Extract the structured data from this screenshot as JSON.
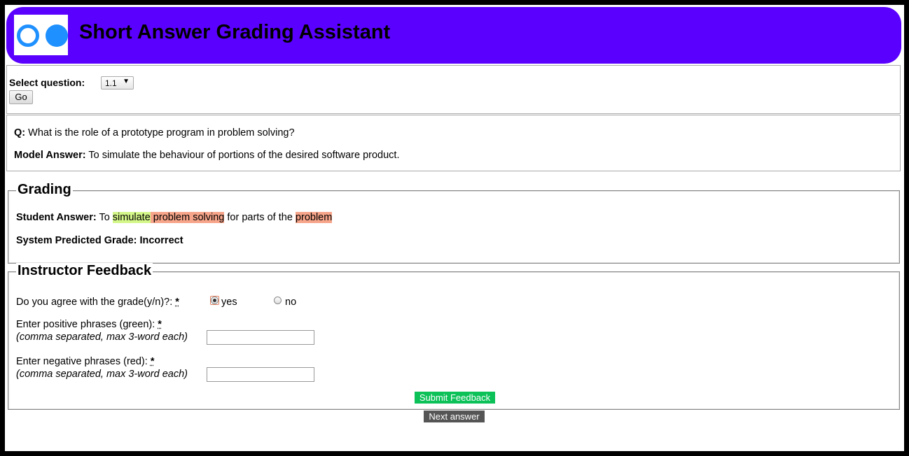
{
  "header": {
    "title": "Short Answer Grading Assistant"
  },
  "question_select": {
    "label": "Select question:",
    "selected": "1.1",
    "go_label": "Go"
  },
  "question": {
    "q_label": "Q:",
    "q_text": " What is the role of a prototype program in problem solving?",
    "model_label": "Model Answer:",
    "model_text": " To simulate the behaviour of portions of the desired software product."
  },
  "grading": {
    "legend": "Grading",
    "student_label": "Student Answer:",
    "answer_parts": [
      {
        "text": " To ",
        "highlight": "none"
      },
      {
        "text": "simulate",
        "highlight": "green"
      },
      {
        "text": " problem solving",
        "highlight": "red"
      },
      {
        "text": " for parts of the ",
        "highlight": "none"
      },
      {
        "text": "problem",
        "highlight": "red"
      }
    ],
    "predicted": "System Predicted Grade: Incorrect"
  },
  "feedback": {
    "legend": "Instructor Feedback",
    "agree_label": "Do you agree with the grade(y/n)?: ",
    "required_mark": "*",
    "yes_label": "yes",
    "no_label": "no",
    "selected": "yes",
    "positive_label": "Enter positive phrases (green): ",
    "negative_label": "Enter negative phrases (red): ",
    "hint": "(comma separated, max 3-word each)",
    "positive_value": "",
    "negative_value": "",
    "submit_label": "Submit Feedback",
    "next_label": "Next answer"
  },
  "colors": {
    "header_bg": "#5a00ff",
    "logo_blue": "#1e90ff",
    "highlight_green": "#d4f78a",
    "highlight_red": "#f7a58a",
    "submit_bg": "#0bc158",
    "next_bg": "#555555"
  }
}
